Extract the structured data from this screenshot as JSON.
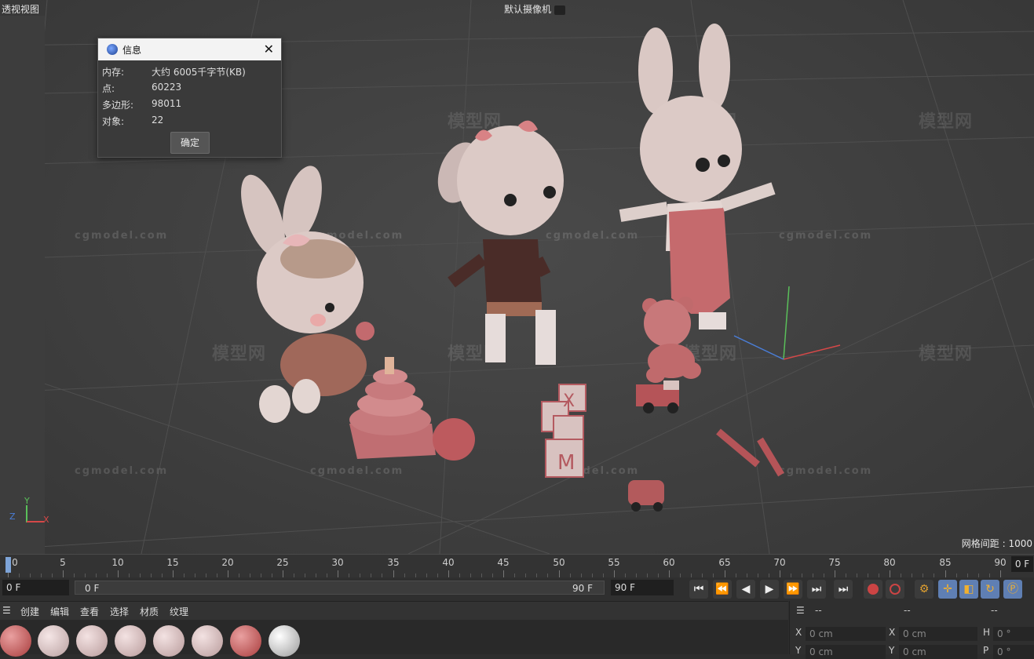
{
  "viewport": {
    "title": "透视视图",
    "camera_label": "默认摄像机",
    "grid_distance": "网格间距 : 1000"
  },
  "watermark": {
    "logo_text": "模型网",
    "site_text": "cgmodel.com"
  },
  "axis_gizmo": {
    "x": "X",
    "y": "Y",
    "z": "Z"
  },
  "info_dialog": {
    "title": "信息",
    "close": "✕",
    "rows": [
      {
        "label": "内存:",
        "value": "大约 6005千字节(KB)"
      },
      {
        "label": "点:",
        "value": "60223"
      },
      {
        "label": "多边形:",
        "value": "98011"
      },
      {
        "label": "对象:",
        "value": "22"
      }
    ],
    "ok_label": "确定"
  },
  "timeline": {
    "ticks": [
      "0",
      "5",
      "10",
      "15",
      "20",
      "25",
      "30",
      "35",
      "40",
      "45",
      "50",
      "55",
      "60",
      "65",
      "70",
      "75",
      "80",
      "85",
      "90"
    ],
    "end_frame": "0 F",
    "current_frame": "0 F",
    "range_start": "0 F",
    "range_end": "90 F",
    "max_frame": "90 F"
  },
  "menu": [
    "创建",
    "编辑",
    "查看",
    "选择",
    "材质",
    "纹理"
  ],
  "attributes": {
    "header": [
      "--",
      "--",
      "--"
    ],
    "fields": [
      {
        "axis": "X",
        "value": "0 cm"
      },
      {
        "axis": "X",
        "value": "0 cm"
      },
      {
        "axis": "H",
        "value": "0 °"
      },
      {
        "axis": "Y",
        "value": "0 cm"
      },
      {
        "axis": "Y",
        "value": "0 cm"
      },
      {
        "axis": "P",
        "value": "0 °"
      }
    ]
  },
  "colors": {
    "accent_blue": "#6d8fc6",
    "viewport_bg": "#434343",
    "figure_pink": "#d9c4c0",
    "toy_red": "#b65a5e"
  }
}
